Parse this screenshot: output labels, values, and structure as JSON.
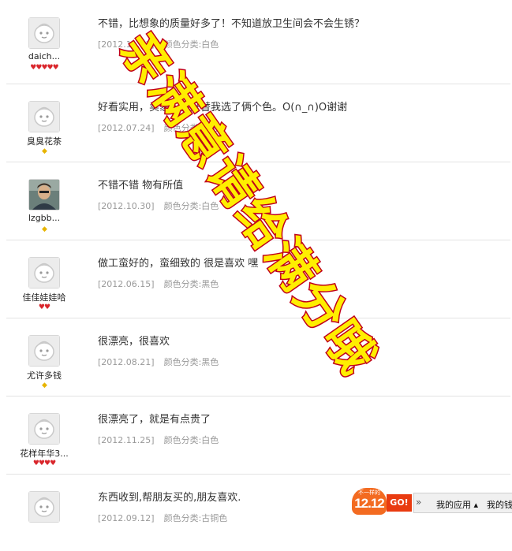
{
  "reviews": [
    {
      "nickname": "daich...",
      "rank": [
        {
          "type": "heart",
          "char": "♥"
        },
        {
          "type": "heart",
          "char": "♥"
        },
        {
          "type": "heart",
          "char": "♥"
        },
        {
          "type": "heart",
          "char": "♥"
        },
        {
          "type": "heart",
          "char": "♥"
        }
      ],
      "text": "不错，比想象的质量好多了！不知道放卫生间会不会生锈？",
      "date": "[2012.11.21]",
      "color": "颜色分类:白色",
      "avatar": "default"
    },
    {
      "nickname": "臭臭花茶",
      "rank": [
        {
          "type": "diamond",
          "char": "◆"
        }
      ],
      "text": "好看实用，卖家人很好替我选了俩个色。O(∩_∩)O谢谢",
      "date": "[2012.07.24]",
      "color": "颜色分类:白色",
      "avatar": "default"
    },
    {
      "nickname": "lzgbb...",
      "rank": [
        {
          "type": "diamond",
          "char": "◆"
        }
      ],
      "text": "不错不错 物有所值",
      "date": "[2012.10.30]",
      "color": "颜色分类:白色",
      "avatar": "photo"
    },
    {
      "nickname": "佳佳娃娃哈",
      "rank": [
        {
          "type": "heart",
          "char": "♥"
        },
        {
          "type": "heart",
          "char": "♥"
        }
      ],
      "text": "做工蛮好的，蛮细致的 很是喜欢 嘿",
      "date": "[2012.06.15]",
      "color": "颜色分类:黑色",
      "avatar": "default"
    },
    {
      "nickname": "尤许多钱",
      "rank": [
        {
          "type": "diamond",
          "char": "◆"
        }
      ],
      "text": "很漂亮，很喜欢",
      "date": "[2012.08.21]",
      "color": "颜色分类:黑色",
      "avatar": "default"
    },
    {
      "nickname": "花样年华3...",
      "rank": [
        {
          "type": "heart",
          "char": "♥"
        },
        {
          "type": "heart",
          "char": "♥"
        },
        {
          "type": "heart",
          "char": "♥"
        },
        {
          "type": "heart",
          "char": "♥"
        }
      ],
      "text": "很漂亮了，就是有点贵了",
      "date": "[2012.11.25]",
      "color": "颜色分类:白色",
      "avatar": "default"
    },
    {
      "nickname": "",
      "rank": [],
      "text": "东西收到,帮朋友买的,朋友喜欢.",
      "date": "[2012.09.12]",
      "color": "颜色分类:古铜色",
      "avatar": "default"
    }
  ],
  "watermark": {
    "line1": "亲满意请给满分哦",
    "fill": "#ffee00",
    "stroke": "#c0001a"
  },
  "promo": {
    "small_text": "不一样的",
    "big_text": "12.12",
    "go_label": "GO!"
  },
  "appbar": {
    "chevron": "»",
    "apps_label": "我的应用 ▴",
    "mine_label": "我的钱"
  },
  "colors": {
    "heart": "#d9262c",
    "diamond": "#e7b400",
    "date": "#999999",
    "promo_orange": "#f36b21"
  }
}
